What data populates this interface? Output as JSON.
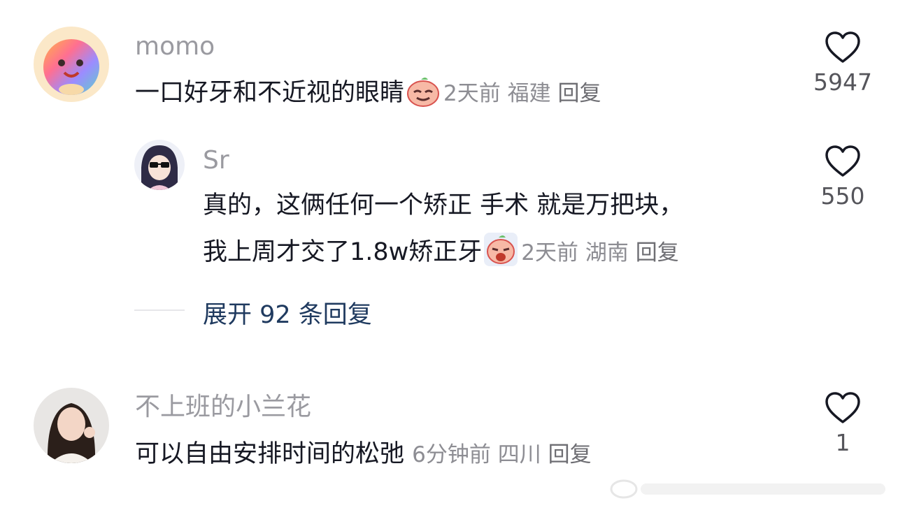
{
  "comments": [
    {
      "username": "momo",
      "text": "一口好牙和不近视的眼睛",
      "time": "2天前",
      "location": "福建",
      "reply_label": "回复",
      "likes": "5947",
      "emoji": "peach-smile-emoji",
      "replies": [
        {
          "username": "Sr",
          "text_line1": "真的，这俩任何一个矫正 手术 就是万把块，",
          "text_line2": "我上周才交了1.8w矫正牙",
          "time": "2天前",
          "location": "湖南",
          "reply_label": "回复",
          "likes": "550",
          "emoji": "peach-crying-emoji"
        }
      ],
      "expand_label": "展开 92 条回复"
    },
    {
      "username": "不上班的小兰花",
      "text": "可以自由安排时间的松弛",
      "time": "6分钟前",
      "location": "四川",
      "reply_label": "回复",
      "likes": "1"
    }
  ],
  "icons": {
    "like": "heart-outline-icon"
  },
  "colors": {
    "username": "#9a9aa0",
    "text": "#161823",
    "meta": "#8d8d93",
    "expand": "#1f3a5f"
  }
}
